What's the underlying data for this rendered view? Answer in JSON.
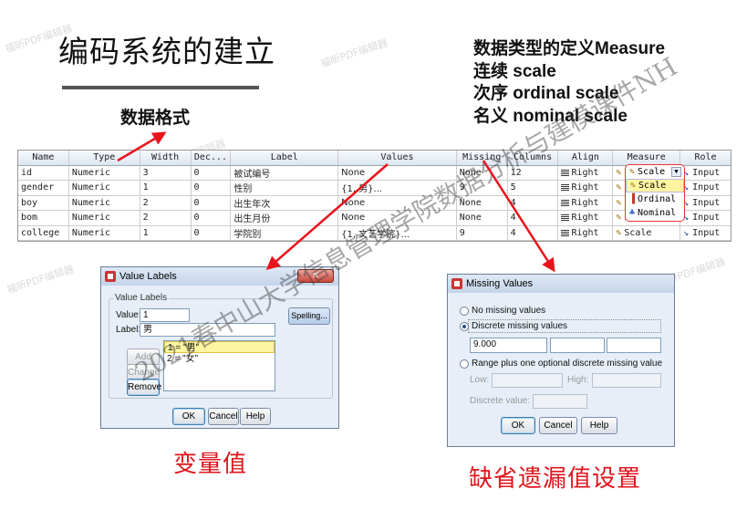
{
  "slide": {
    "title": "编码系统的建立",
    "format_label": "数据格式",
    "types": {
      "heading": "数据类型的定义Measure",
      "scale": "连续 scale",
      "ordinal": "次序 ordinal scale",
      "nominal": "名义 nominal scale"
    },
    "caption_value_labels": "变量值",
    "caption_missing": "缺省遗漏值设置",
    "watermark": "福昕PDF编辑器",
    "overlay_watermark": "2021春中山大学信息管理学院数据分析与建模课件NH"
  },
  "grid": {
    "headers": [
      "Name",
      "Type",
      "Width",
      "Dec...",
      "Label",
      "Values",
      "Missing",
      "Columns",
      "Align",
      "Measure",
      "Role"
    ],
    "rows": [
      [
        "id",
        "Numeric",
        "3",
        "0",
        "被试编号",
        "None",
        "None",
        "12",
        "Right",
        "Scale",
        "Input"
      ],
      [
        "gender",
        "Numeric",
        "1",
        "0",
        "性别",
        "{1, 男}...",
        "9",
        "5",
        "Right",
        "Scale",
        "Input"
      ],
      [
        "boy",
        "Numeric",
        "2",
        "0",
        "出生年次",
        "None",
        "None",
        "4",
        "Right",
        "Scale",
        "Input"
      ],
      [
        "bom",
        "Numeric",
        "2",
        "0",
        "出生月份",
        "None",
        "None",
        "4",
        "Right",
        "Scale",
        "Input"
      ],
      [
        "college",
        "Numeric",
        "1",
        "0",
        "学院别",
        "{1, 文艺学院}...",
        "9",
        "4",
        "Right",
        "Scale",
        "Input"
      ]
    ],
    "measure_options": [
      "Scale",
      "Ordinal",
      "Nominal"
    ],
    "measure_selected": "Scale"
  },
  "value_labels_dialog": {
    "title": "Value Labels",
    "group_label": "Value Labels",
    "value_label": "Value:",
    "value": "1",
    "label_label": "Label:",
    "label": "男",
    "spelling": "Spelling...",
    "list": [
      "1 = \"男\"",
      "2 = \"女\""
    ],
    "add": "Add",
    "change": "Change",
    "remove": "Remove",
    "ok": "OK",
    "cancel": "Cancel",
    "help": "Help"
  },
  "missing_dialog": {
    "title": "Missing Values",
    "no_missing": "No missing values",
    "discrete": "Discrete missing values",
    "discrete_values": [
      "9.000",
      "",
      ""
    ],
    "range": "Range plus one optional discrete missing value",
    "low": "Low:",
    "high": "High:",
    "discrete_value": "Discrete value:",
    "ok": "OK",
    "cancel": "Cancel",
    "help": "Help"
  },
  "colors": {
    "accent_red": "#e0141c",
    "arrow_red": "#e8141c"
  }
}
